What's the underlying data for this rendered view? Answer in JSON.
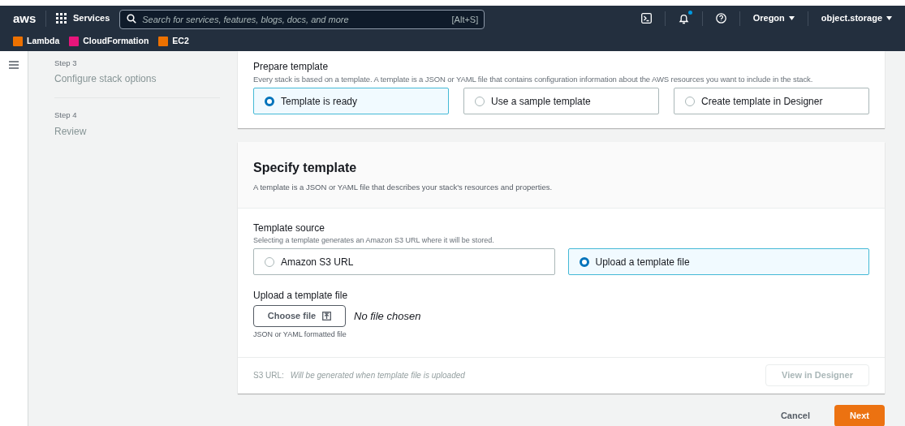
{
  "nav": {
    "logo": "aws",
    "services": "Services",
    "search_placeholder": "Search for services, features, blogs, docs, and more",
    "shortcut": "[Alt+S]",
    "has_notification": true,
    "region": "Oregon",
    "account": "object.storage"
  },
  "favorites": [
    {
      "label": "Lambda",
      "color": "#ed7100"
    },
    {
      "label": "CloudFormation",
      "color": "#e7157b"
    },
    {
      "label": "EC2",
      "color": "#ed7100"
    }
  ],
  "steps": [
    {
      "step": "Step 3",
      "title": "Configure stack options"
    },
    {
      "step": "Step 4",
      "title": "Review"
    }
  ],
  "prepare_template": {
    "title": "Prepare template",
    "description": "Every stack is based on a template. A template is a JSON or YAML file that contains configuration information about the AWS resources you want to include in the stack.",
    "options": [
      {
        "label": "Template is ready",
        "selected": true
      },
      {
        "label": "Use a sample template",
        "selected": false
      },
      {
        "label": "Create template in Designer",
        "selected": false
      }
    ]
  },
  "specify_template": {
    "title": "Specify template",
    "description": "A template is a JSON or YAML file that describes your stack's resources and properties.",
    "source_label": "Template source",
    "source_hint": "Selecting a template generates an Amazon S3 URL where it will be stored.",
    "options": [
      {
        "label": "Amazon S3 URL",
        "selected": false
      },
      {
        "label": "Upload a template file",
        "selected": true
      }
    ],
    "upload_label": "Upload a template file",
    "choose_button": "Choose file",
    "file_status": "No file chosen",
    "upload_hint": "JSON or YAML formatted file",
    "s3_label": "S3 URL:",
    "s3_value": "Will be generated when template file is uploaded",
    "designer_button": {
      "label": "View in Designer",
      "disabled": true
    }
  },
  "actions": {
    "cancel": "Cancel",
    "next": "Next"
  }
}
